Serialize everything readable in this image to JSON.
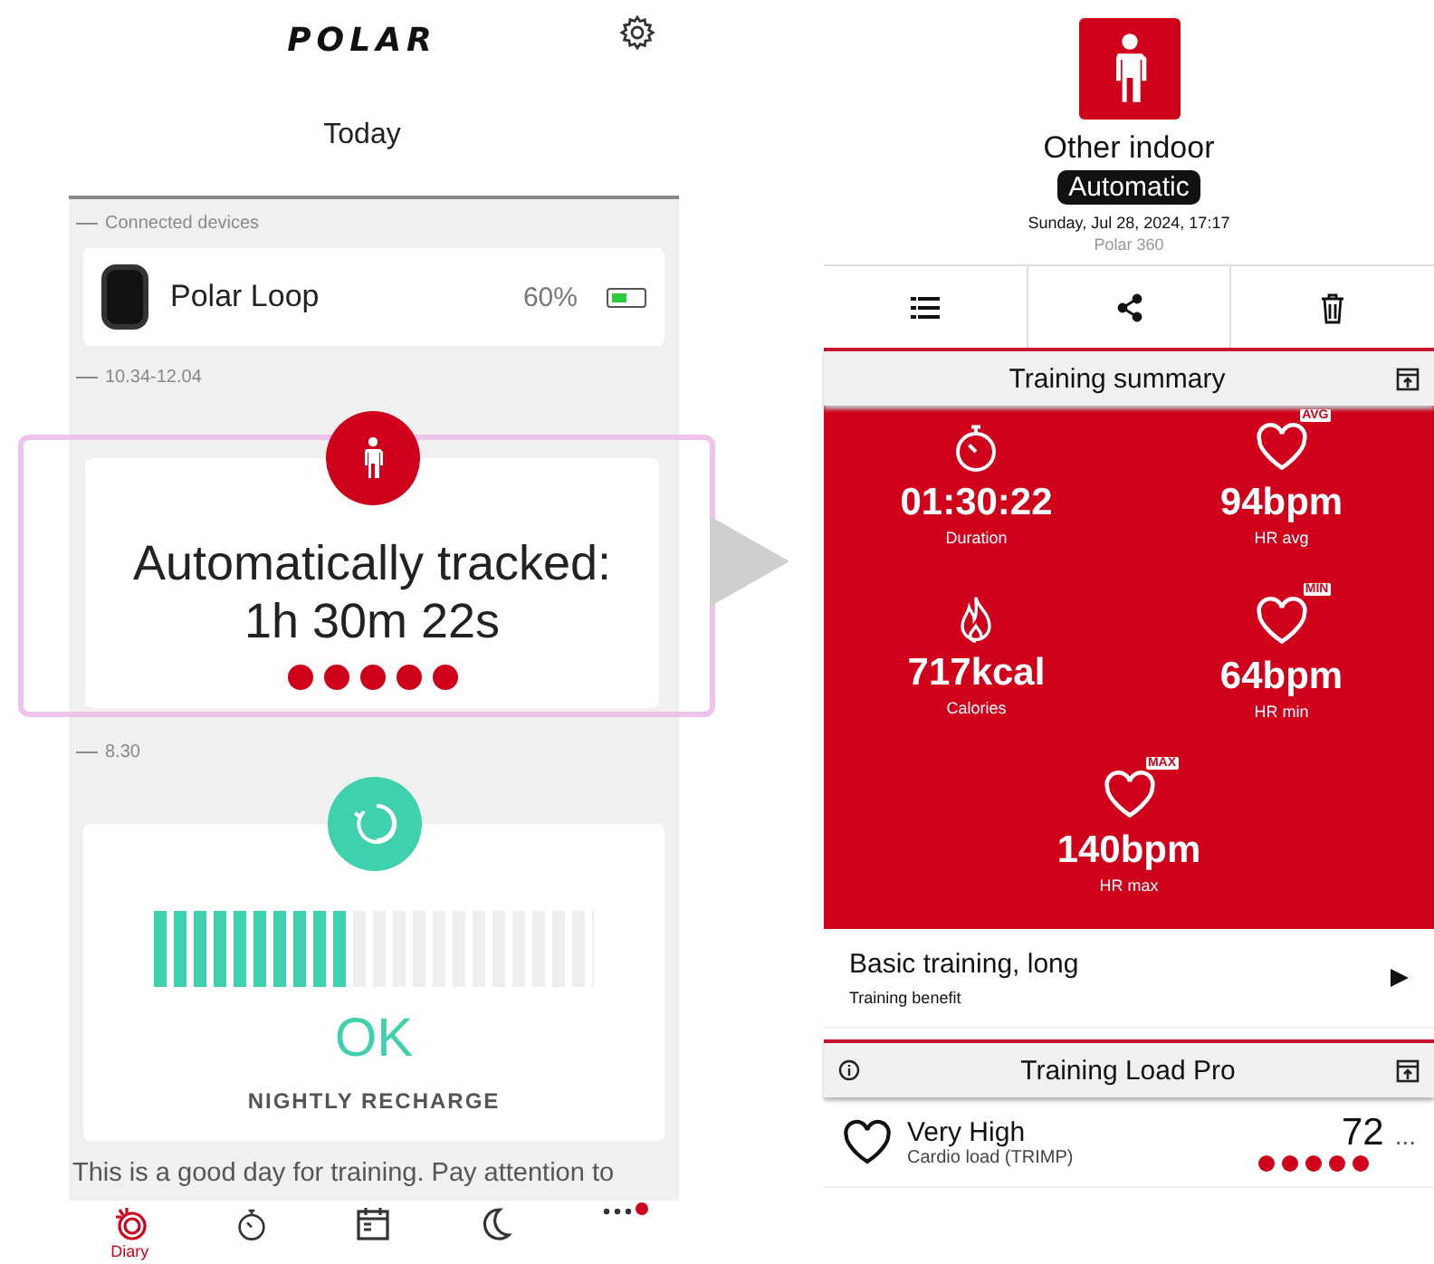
{
  "today": {
    "logo": "POLAR",
    "title": "Today",
    "devices_label": "Connected devices",
    "device": {
      "name": "Polar Loop",
      "battery": "60%"
    },
    "tracked": {
      "time_label": "10.34-12.04",
      "title": "Automatically tracked:",
      "duration": "1h 30m 22s",
      "stars": 5
    },
    "recharge": {
      "time_label": "8.30",
      "level": 0.45,
      "status": "OK",
      "label": "NIGHTLY RECHARGE"
    },
    "note": "This is a good day for training. Pay attention to"
  },
  "nav": [
    {
      "kind": "diary",
      "label": "Diary",
      "selected": true,
      "notification": false
    },
    {
      "kind": "stopwatch",
      "selected": false,
      "notification": false
    },
    {
      "kind": "calendar",
      "selected": false,
      "notification": false
    },
    {
      "kind": "moon",
      "selected": false,
      "notification": false
    },
    {
      "kind": "more",
      "selected": false,
      "notification": true
    }
  ],
  "training": {
    "sport": "Other indoor",
    "tag": "Automatic",
    "date": "Sunday, Jul 28, 2024, 17:17",
    "device": "Polar 360",
    "actions": [
      {
        "kind": "list"
      },
      {
        "kind": "share"
      },
      {
        "kind": "delete"
      }
    ],
    "summary": {
      "title": "Training summary",
      "stats": [
        {
          "kind": "stopwatch",
          "value": "01:30:22",
          "label": "Duration"
        },
        {
          "kind": "heart",
          "badge": "AVG",
          "value": "94bpm",
          "label": "HR avg"
        },
        {
          "kind": "flame",
          "value": "717kcal",
          "label": "Calories"
        },
        {
          "kind": "heart",
          "badge": "MIN",
          "value": "64bpm",
          "label": "HR min"
        },
        {
          "kind": "heart",
          "badge": "MAX",
          "value": "140bpm",
          "label": "HR max"
        }
      ]
    },
    "benefit": {
      "value": "Basic training, long",
      "label": "Training benefit"
    },
    "load": {
      "title": "Training Load Pro",
      "items": [
        {
          "kind": "cardio",
          "value": "Very High",
          "label": "Cardio load (TRIMP)",
          "score": "72",
          "more": "...",
          "stars": 5
        }
      ]
    }
  }
}
